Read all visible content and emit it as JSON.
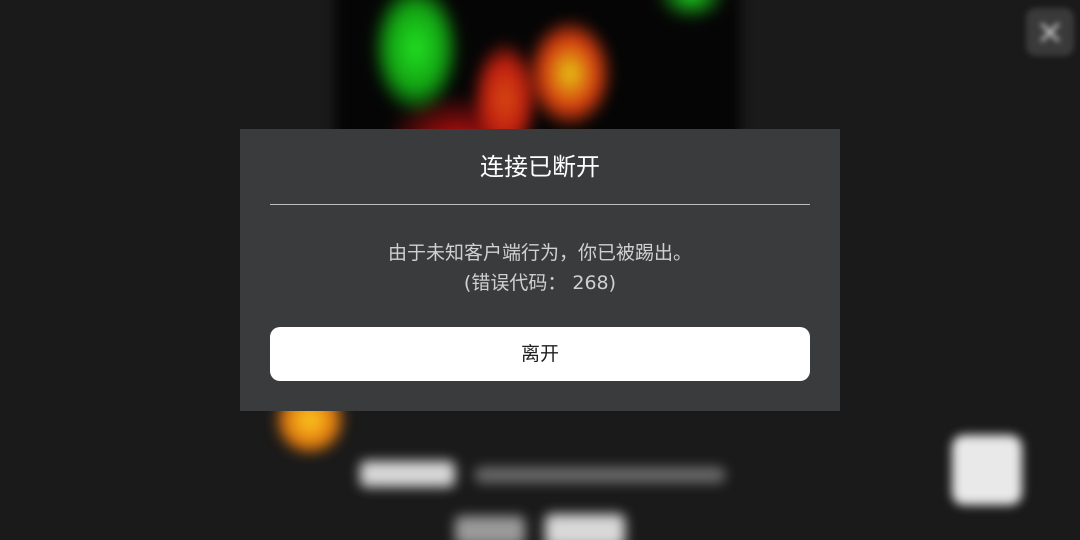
{
  "dialog": {
    "title": "连接已断开",
    "message_line1": "由于未知客户端行为，你已被踢出。",
    "message_line2": "(错误代码： 268)",
    "leave_label": "离开"
  },
  "background": {
    "close_glyph": "×"
  },
  "colors": {
    "dialog_bg": "#393b3d",
    "button_bg": "#ffffff",
    "page_bg": "#1a1a1a"
  }
}
